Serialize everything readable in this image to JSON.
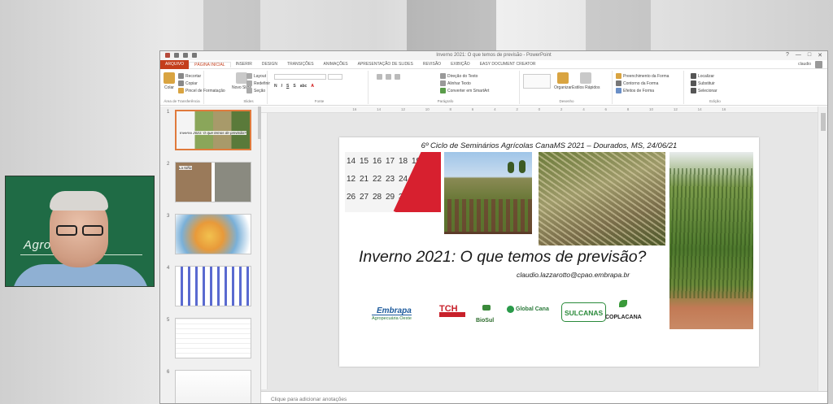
{
  "window": {
    "title": "Inverno 2021: O que temos de previsão - PowerPoint",
    "controls": [
      "?",
      "—",
      "□",
      "✕"
    ]
  },
  "ribbon_tabs": [
    {
      "label": "ARQUIVO",
      "kind": "file"
    },
    {
      "label": "PÁGINA INICIAL",
      "kind": "active"
    },
    {
      "label": "INSERIR",
      "kind": "normal"
    },
    {
      "label": "DESIGN",
      "kind": "normal"
    },
    {
      "label": "TRANSIÇÕES",
      "kind": "normal"
    },
    {
      "label": "ANIMAÇÕES",
      "kind": "normal"
    },
    {
      "label": "APRESENTAÇÃO DE SLIDES",
      "kind": "normal"
    },
    {
      "label": "REVISÃO",
      "kind": "normal"
    },
    {
      "label": "EXIBIÇÃO",
      "kind": "normal"
    },
    {
      "label": "Easy Document Creator",
      "kind": "normal"
    }
  ],
  "user_name": "claudio",
  "ribbon": {
    "clipboard": {
      "paste": "Colar",
      "cut": "Recortar",
      "copy": "Copiar",
      "format": "Pincel de Formatação",
      "group": "Área de Transferência"
    },
    "slides": {
      "new": "Novo Slide",
      "layout": "Layout",
      "reset": "Redefinir",
      "section": "Seção",
      "group": "Slides"
    },
    "font": {
      "group": "Fonte"
    },
    "paragraph": {
      "direction": "Direção do Texto",
      "align": "Alinhar Texto",
      "smartart": "Converter em SmartArt",
      "group": "Parágrafo"
    },
    "drawing": {
      "arrange": "Organizar",
      "quick": "Estilos Rápidos",
      "fill": "Preenchimento da Forma",
      "outline": "Contorno da Forma",
      "effects": "Efeitos de Forma",
      "group": "Desenho"
    },
    "editing": {
      "find": "Localizar",
      "replace": "Substituir",
      "select": "Selecionar",
      "group": "Edição"
    }
  },
  "thumbnails": [
    {
      "num": "1",
      "caption": "Inverno 2021: O que temos de previsão?"
    },
    {
      "num": "2",
      "caption": "La Niña"
    },
    {
      "num": "3",
      "caption": ""
    },
    {
      "num": "4",
      "caption": ""
    },
    {
      "num": "5",
      "caption": ""
    },
    {
      "num": "6",
      "caption": ""
    }
  ],
  "slide": {
    "header": "6º Ciclo de Seminários Agrícolas CanaMS 2021 – Dourados, MS, 24/06/21",
    "title": "Inverno 2021: O que temos de previsão?",
    "email": "claudio.lazzarotto@cpao.embrapa.br",
    "calendar_numbers": [
      "14",
      "15",
      "16",
      "17",
      "18",
      "19",
      "12",
      "21",
      "22",
      "23",
      "24",
      "25",
      "26",
      "27",
      "28",
      "29",
      "30"
    ],
    "logos": {
      "embrapa": "Embrapa",
      "embrapa_sub": "Agropecuária Oeste",
      "tch": "TCH",
      "biosul": "BioSul",
      "globalcana": "Global Cana",
      "sulcanas": "SULCANAS",
      "coplacana": "COPLACANA"
    }
  },
  "notes_placeholder": "Clique para adicionar anotações",
  "webcam": {
    "brand": "Agro         Oeste"
  },
  "colors": {
    "file_tab": "#c43e1c",
    "cam_bg": "#1f6b45",
    "selection": "#e07a3c"
  }
}
